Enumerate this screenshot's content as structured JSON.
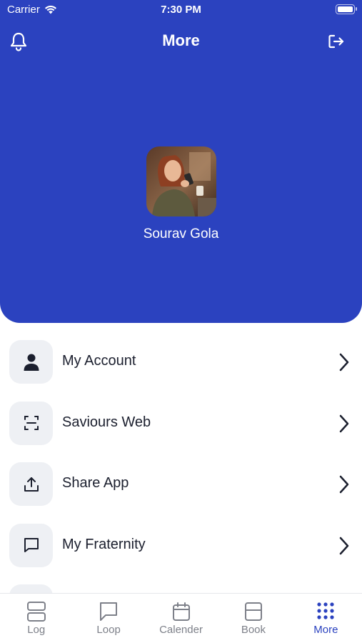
{
  "status_bar": {
    "carrier": "Carrier",
    "time": "7:30 PM"
  },
  "header": {
    "title": "More",
    "left_icon": "bell-icon",
    "right_icon": "logout-icon"
  },
  "profile": {
    "name": "Sourav Gola"
  },
  "menu": {
    "items": [
      {
        "label": "My Account",
        "icon": "person-icon"
      },
      {
        "label": "Saviours Web",
        "icon": "scan-icon"
      },
      {
        "label": "Share App",
        "icon": "share-icon"
      },
      {
        "label": "My Fraternity",
        "icon": "chat-icon"
      }
    ]
  },
  "tabs": [
    {
      "label": "Log",
      "icon": "log-icon"
    },
    {
      "label": "Loop",
      "icon": "loop-icon"
    },
    {
      "label": "Calender",
      "icon": "calendar-icon"
    },
    {
      "label": "Book",
      "icon": "book-icon"
    },
    {
      "label": "More",
      "icon": "grid-icon",
      "active": true
    }
  ],
  "colors": {
    "brand": "#2b42bf",
    "icon_bg": "#eef0f4",
    "text": "#1b1f2e",
    "tab_inactive": "#7d8089"
  }
}
